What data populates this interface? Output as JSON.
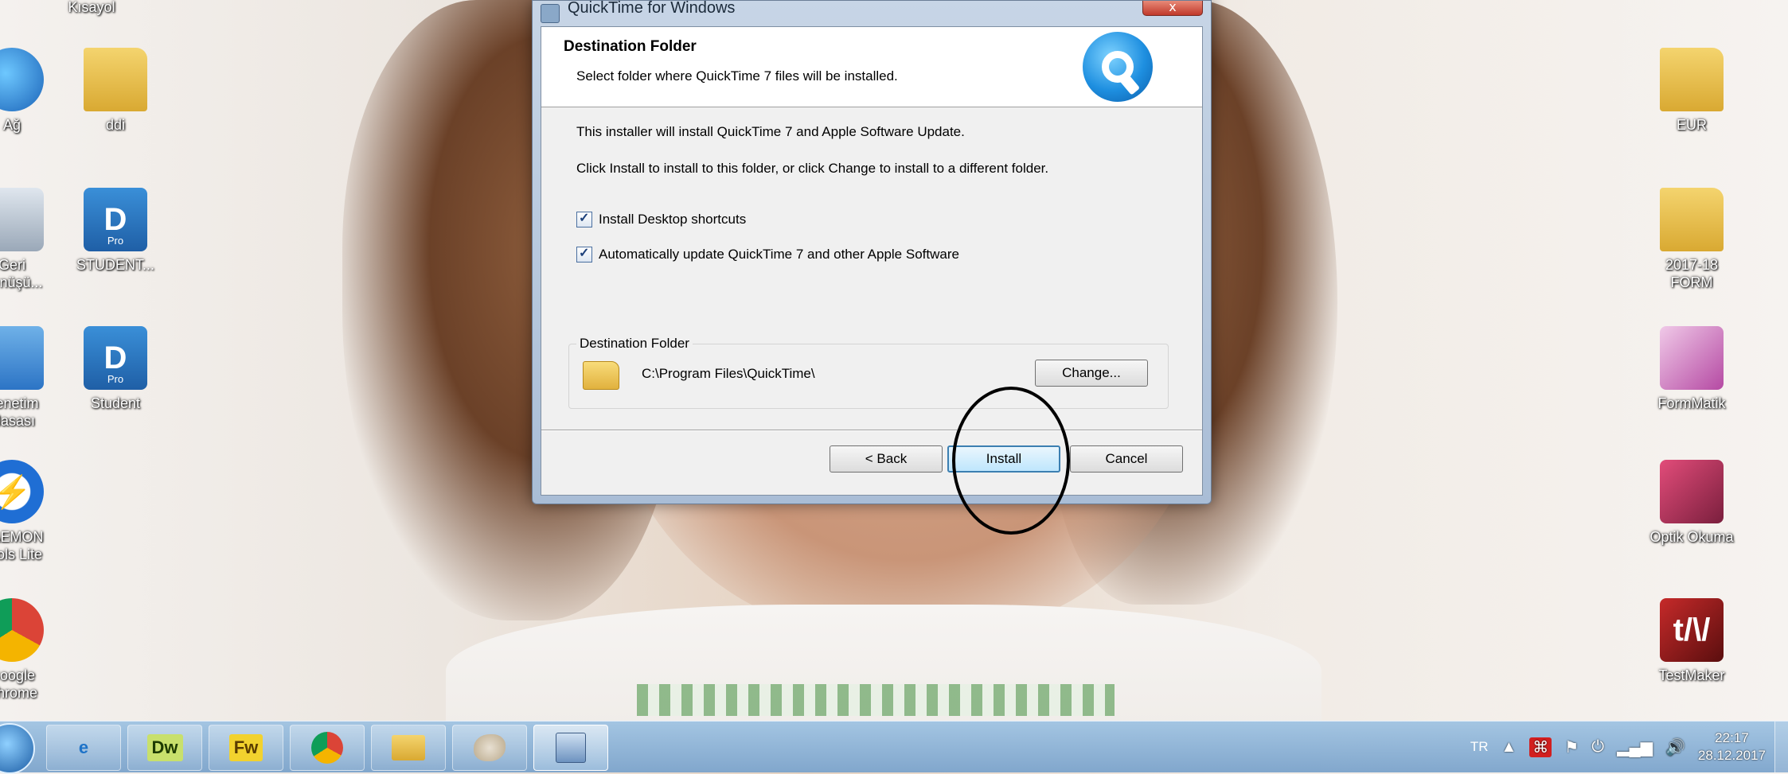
{
  "desktop": {
    "left_icons": [
      {
        "label": "Kısayol",
        "name": "kisayol"
      },
      {
        "label": "Ağ",
        "name": "network"
      },
      {
        "label": "ddi",
        "name": "ddi-folder"
      },
      {
        "label": "Geri\nDönüşü...",
        "name": "recycle-bin"
      },
      {
        "label": "STUDENT...",
        "name": "student-pro-1"
      },
      {
        "label": "Denetim\nMasası",
        "name": "control-panel"
      },
      {
        "label": "Student",
        "name": "student-pro-2"
      },
      {
        "label": "DAEMON\nTools Lite",
        "name": "daemon-tools"
      },
      {
        "label": "Google\nChrome",
        "name": "google-chrome"
      }
    ],
    "right_icons": [
      {
        "label": "EUR",
        "name": "eur-folder"
      },
      {
        "label": "2017-18\nFORM",
        "name": "form-folder"
      },
      {
        "label": "FormMatik",
        "name": "formmatik"
      },
      {
        "label": "Optik Okuma",
        "name": "optik-okuma"
      },
      {
        "label": "TestMaker",
        "name": "testmaker"
      }
    ],
    "pro_badge": "Pro"
  },
  "dialog": {
    "title": "QuickTime for Windows",
    "close_label": "x",
    "header_title": "Destination Folder",
    "header_subtitle": "Select folder where QuickTime 7 files will be installed.",
    "line1": "This installer will install QuickTime 7 and Apple Software Update.",
    "line2": "Click Install to install to this folder, or click Change to install to a different folder.",
    "checkbox1": "Install Desktop shortcuts",
    "checkbox2": "Automatically update QuickTime 7 and other Apple Software",
    "dest_legend": "Destination Folder",
    "dest_path": "C:\\Program Files\\QuickTime\\",
    "change_button": "Change...",
    "back_button": "< Back",
    "install_button": "Install",
    "cancel_button": "Cancel"
  },
  "taskbar": {
    "apps": [
      {
        "label": "",
        "name": "ie"
      },
      {
        "label": "Dw",
        "name": "dreamweaver"
      },
      {
        "label": "Fw",
        "name": "fireworks"
      },
      {
        "label": "",
        "name": "chrome"
      },
      {
        "label": "",
        "name": "explorer"
      },
      {
        "label": "",
        "name": "paint"
      },
      {
        "label": "",
        "name": "installer"
      }
    ],
    "lang": "TR",
    "time": "22:17",
    "date": "28.12.2017"
  },
  "colors": {
    "install_focus": "#3c7fb1",
    "annotation": "#000000"
  }
}
